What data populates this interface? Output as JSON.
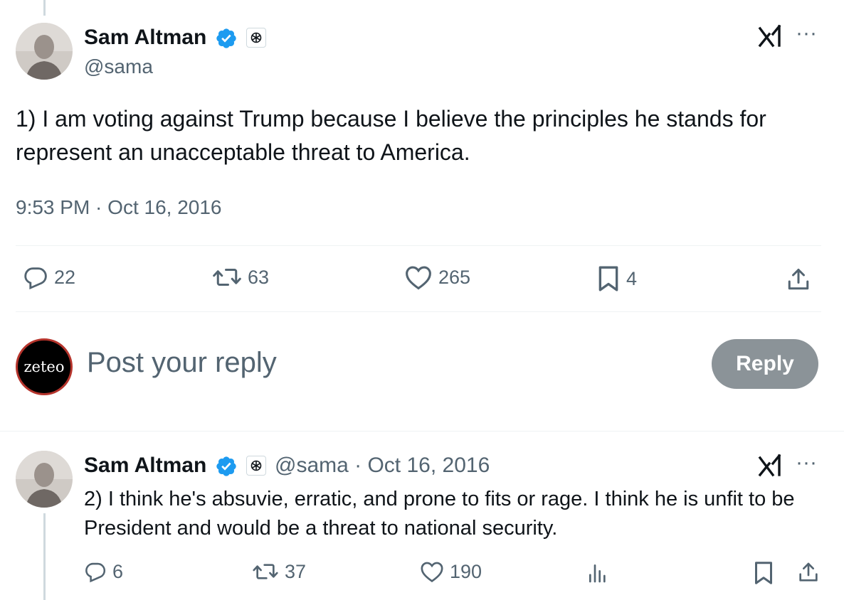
{
  "main_post": {
    "author_name": "Sam Altman",
    "author_handle": "@sama",
    "text": "1) I am voting against Trump because I believe the principles he stands for represent an unacceptable threat to America.",
    "timestamp": "9:53 PM · Oct 16, 2016",
    "stats": {
      "replies": "22",
      "reposts": "63",
      "likes": "265",
      "bookmarks": "4"
    }
  },
  "composer": {
    "avatar_text": "zeteo",
    "placeholder": "Post your reply",
    "reply_label": "Reply"
  },
  "reply_post": {
    "author_name": "Sam Altman",
    "meta": "@sama · Oct 16, 2016",
    "text": "2) I think he's absuvie, erratic, and prone to fits or rage. I think he is unfit to be President and would be a threat to national security.",
    "stats": {
      "replies": "6",
      "reposts": "37",
      "likes": "190"
    }
  },
  "icons": [
    "verified-badge-icon",
    "openai-org-badge-icon",
    "grok-icon",
    "more-icon",
    "reply-icon",
    "repost-icon",
    "like-icon",
    "bookmark-icon",
    "share-icon",
    "views-icon"
  ],
  "colors": {
    "text": "#0f1419",
    "secondary": "#536471",
    "verified": "#1d9bf0",
    "divider": "#eff3f4",
    "reply_button": "#8b9398"
  }
}
